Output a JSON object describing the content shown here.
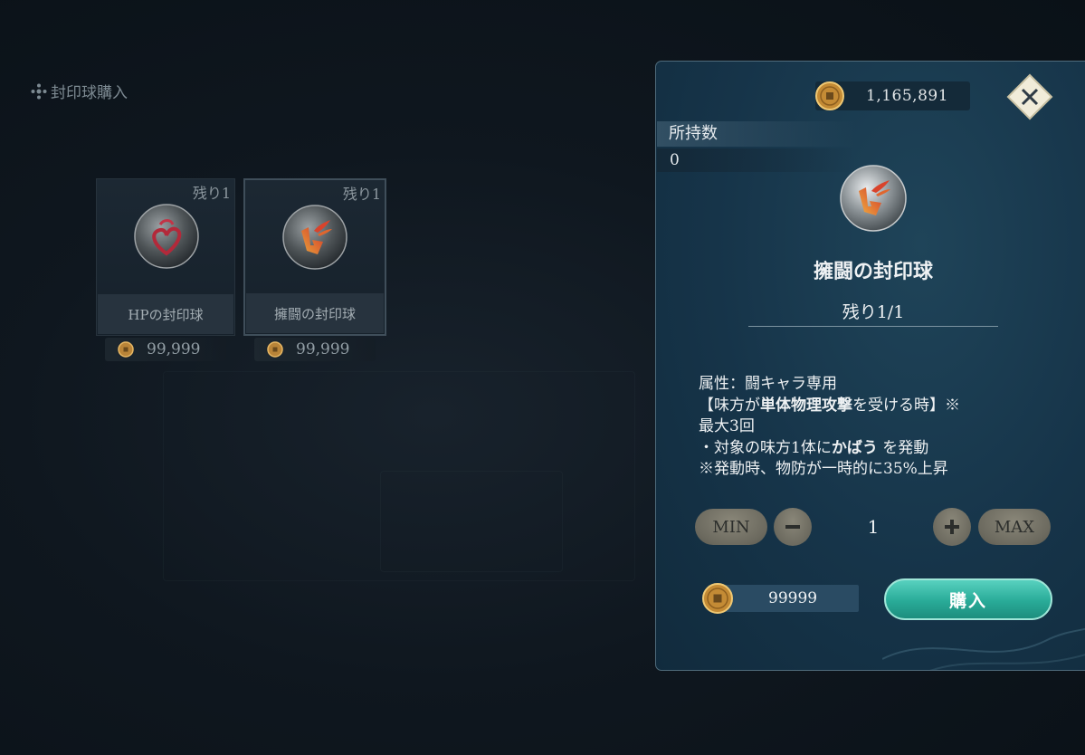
{
  "page_title": "封印球購入",
  "shop_items": [
    {
      "name": "HPの封印球",
      "remaining": "残り1",
      "price": "99,999",
      "orb": "hp-seal-orb"
    },
    {
      "name": "擁闘の封印球",
      "remaining": "残り1",
      "price": "99,999",
      "orb": "guard-seal-orb"
    }
  ],
  "detail": {
    "currency": "1,165,891",
    "owned_label": "所持数",
    "owned_value": "0",
    "item_name": "擁闘の封印球",
    "remaining": "残り1/1",
    "description": {
      "line1": "属性：闘キャラ専用",
      "line2_pre": "【味方が",
      "line2_bold": "単体物理攻撃",
      "line2_post": "を受ける時】※",
      "line3": "最大3回",
      "line4_pre": "・対象の味方1体に",
      "line4_bold": "かばう",
      "line4_post": " を発動",
      "line5": "※発動時、物防が一時的に35%上昇"
    },
    "quantity": {
      "min_label": "MIN",
      "max_label": "MAX",
      "minus_icon": "minus-icon",
      "plus_icon": "plus-icon",
      "value": "1"
    },
    "cost": "99999",
    "buy_label": "購入"
  },
  "colors": {
    "panel_bg": "#163449",
    "buy_button": "#29ab98",
    "qty_button": "#6c6a5f",
    "coin": "#d49a3a",
    "close_button": "#f3eedd"
  }
}
